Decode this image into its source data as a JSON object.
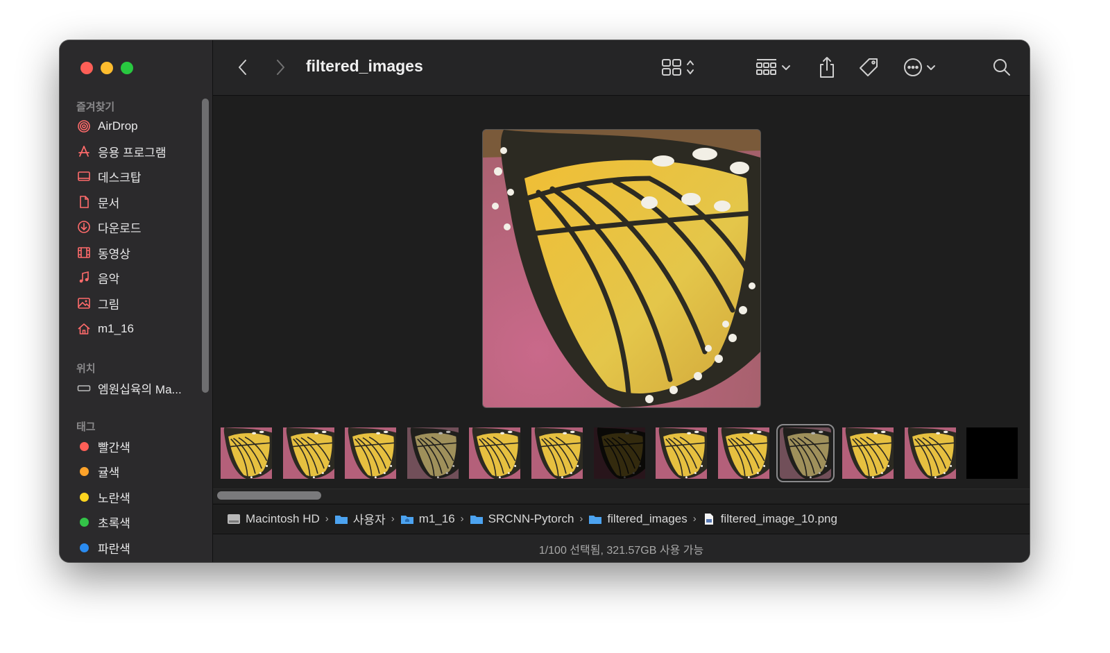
{
  "window": {
    "title": "filtered_images"
  },
  "sidebar": {
    "favorites_header": "즐겨찾기",
    "favorites": [
      {
        "label": "AirDrop",
        "icon": "airdrop-icon"
      },
      {
        "label": "응용 프로그램",
        "icon": "applications-icon"
      },
      {
        "label": "데스크탑",
        "icon": "desktop-icon"
      },
      {
        "label": "문서",
        "icon": "document-icon"
      },
      {
        "label": "다운로드",
        "icon": "download-icon"
      },
      {
        "label": "동영상",
        "icon": "movies-icon"
      },
      {
        "label": "음악",
        "icon": "music-icon"
      },
      {
        "label": "그림",
        "icon": "pictures-icon"
      },
      {
        "label": "m1_16",
        "icon": "home-icon"
      }
    ],
    "locations_header": "위치",
    "locations": [
      {
        "label": "엠원십육의 Ma...",
        "icon": "disk-icon"
      }
    ],
    "tags_header": "태그",
    "tags": [
      {
        "label": "빨간색",
        "color": "#fe5f57"
      },
      {
        "label": "귤색",
        "color": "#fea32a"
      },
      {
        "label": "노란색",
        "color": "#fdd41f"
      },
      {
        "label": "초록색",
        "color": "#33c448"
      },
      {
        "label": "파란색",
        "color": "#2a8bf0"
      }
    ]
  },
  "accent_color": "#ff6b6b",
  "pathbar": [
    {
      "label": "Macintosh HD",
      "icon": "hard-drive-icon"
    },
    {
      "label": "사용자",
      "icon": "folder-icon"
    },
    {
      "label": "m1_16",
      "icon": "home-folder-icon"
    },
    {
      "label": "SRCNN-Pytorch",
      "icon": "folder-icon"
    },
    {
      "label": "filtered_images",
      "icon": "folder-icon"
    },
    {
      "label": "filtered_image_10.png",
      "icon": "png-file-icon"
    }
  ],
  "status": "1/100 선택됨, 321.57GB 사용 가능",
  "gallery": {
    "selected_index": 9,
    "thumbnails": [
      {
        "variant": "normal"
      },
      {
        "variant": "normal"
      },
      {
        "variant": "normal"
      },
      {
        "variant": "faded"
      },
      {
        "variant": "normal"
      },
      {
        "variant": "normal"
      },
      {
        "variant": "dark"
      },
      {
        "variant": "normal"
      },
      {
        "variant": "normal"
      },
      {
        "variant": "faded"
      },
      {
        "variant": "normal"
      },
      {
        "variant": "normal"
      },
      {
        "variant": "black"
      }
    ]
  }
}
